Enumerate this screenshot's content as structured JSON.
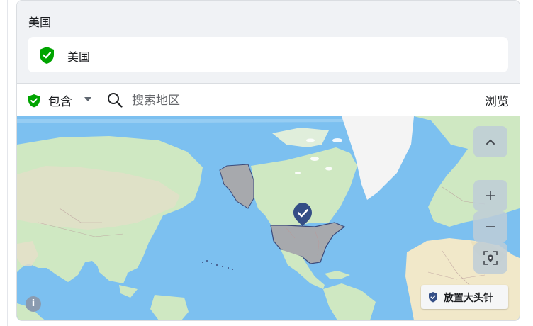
{
  "selected": {
    "title": "美国",
    "items": [
      {
        "label": "美国",
        "status": "included"
      }
    ]
  },
  "toolbar": {
    "mode_label": "包含",
    "search_placeholder": "搜索地区",
    "browse_label": "浏览"
  },
  "map": {
    "highlighted_region": "美国",
    "drop_pin_label": "放置大头针",
    "info_symbol": "i"
  },
  "colors": {
    "include_green": "#00a400",
    "pin_navy": "#344e86",
    "ocean": "#7cc0f0",
    "land": "#cfe8c2",
    "selected_fill": "#a7a9ad"
  },
  "icons": [
    "include-shield-icon",
    "chevron-down-icon",
    "search-icon",
    "chevron-up-icon",
    "zoom-in-icon",
    "zoom-out-icon",
    "locate-icon",
    "map-pin-marker",
    "pin-icon",
    "info-icon"
  ]
}
